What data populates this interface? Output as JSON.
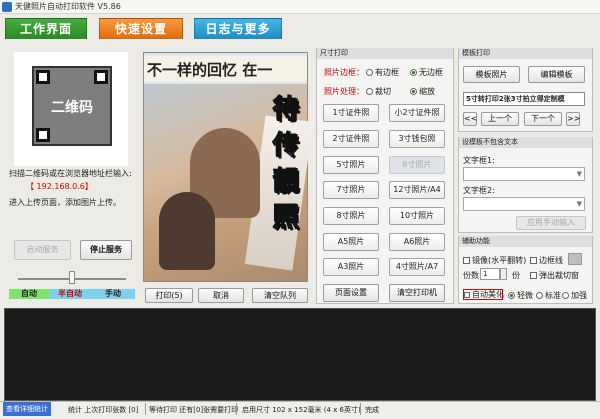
{
  "window": {
    "title": "天健照片自动打印软件 V5.86"
  },
  "tabs": [
    {
      "label": "工作界面",
      "color": "#2b8b26"
    },
    {
      "label": "快速设置",
      "color": "#e06d0e"
    },
    {
      "label": "日志与更多",
      "color": "#1f8fc6"
    }
  ],
  "left": {
    "qr_label": "二维码",
    "scan_text": "扫描二维码或在浏览器地址栏输入:",
    "ip": "【 192.168.0.6】",
    "upload_text": "进入上传页面，添加图片上传。",
    "start_service": "启动服务",
    "stop_service": "停止服务",
    "mode_auto": "自动",
    "mode_semi": "半自动",
    "mode_manual": "手动"
  },
  "photo": {
    "slogan": "不一样的回忆 在一",
    "vertical_text": "待传靓照",
    "print": "打印(5)",
    "cancel": "取消",
    "clear_queue": "清空队列"
  },
  "size_group": {
    "title": "尺寸打印",
    "border_label": "照片边框：",
    "border_opt1": "有边框",
    "border_opt2": "无边框",
    "process_label": "照片处理：",
    "process_opt1": "裁切",
    "process_opt2": "缩放",
    "sizes": [
      [
        "1寸证件照",
        "小2寸证件照"
      ],
      [
        "2寸证件照",
        "3寸钱包照"
      ],
      [
        "5寸照片",
        "6寸照片"
      ],
      [
        "7寸照片",
        "12寸照片/A4"
      ],
      [
        "8寸照片",
        "10寸照片"
      ],
      [
        "A5照片",
        "A6照片"
      ],
      [
        "A3照片",
        "4寸照片/A7"
      ]
    ],
    "page_setup": "页面设置",
    "clear_printer": "清空打印机"
  },
  "template_group": {
    "title": "模板打印",
    "tpl_photo": "模板照片",
    "tpl_edit": "编辑模板",
    "selected": "5寸转打印2张3寸拍立得定制模",
    "first": "<<",
    "prev": "上一个",
    "next": "下一个",
    "last": ">>"
  },
  "text_group": {
    "title": "设模板不包含文本",
    "field1": "文字框1:",
    "field2": "文字框2:",
    "apply": "应用手动输入"
  },
  "aux_group": {
    "title": "辅助功能",
    "mirror": "镜像(水平翻转)",
    "border_line": "边框线",
    "copies_label": "份数:",
    "copies_value": "1",
    "copies_unit": "份",
    "eject_cut": "弹出裁切窗",
    "auto_beauty": "自动美化",
    "light": "轻微",
    "standard": "标准",
    "strong": "加强"
  },
  "status": {
    "view_stats": "查看详细统计",
    "stats": "统计 上次打印张数 [0]",
    "wait": "等待打印 还有[0]张需要打印",
    "size": "启用尺寸 102 x 152毫米 (4 x 6英寸)",
    "done": "完成"
  }
}
